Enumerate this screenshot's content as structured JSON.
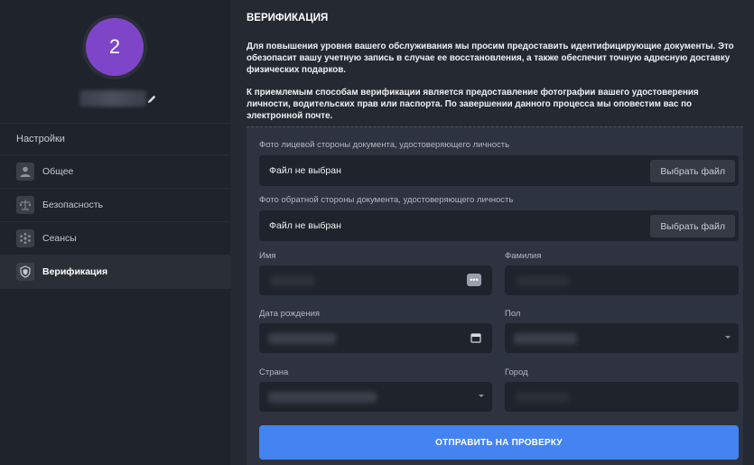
{
  "sidebar": {
    "avatar_number": "2",
    "settings_title": "Настройки",
    "items": [
      {
        "label": "Общее",
        "icon": "user-icon"
      },
      {
        "label": "Безопасность",
        "icon": "scales-icon"
      },
      {
        "label": "Сеансы",
        "icon": "sessions-icon"
      },
      {
        "label": "Верификация",
        "icon": "shield-icon",
        "active": true
      }
    ]
  },
  "main": {
    "title": "ВЕРИФИКАЦИЯ",
    "intro_1": "Для повышения уровня вашего обслуживания мы просим предоставить идентифицирующие документы. Это обезопасит вашу учетную запись в случае ее восстановления, а также обеспечит точную адресную доставку физических подарков.",
    "intro_2": "К приемлемым способам верификации является предоставление фотографии вашего удостоверения личности, водительских прав или паспорта. По завершении данного процесса мы оповестим вас по электронной почте.",
    "form": {
      "front_label": "Фото лицевой стороны документа, удостоверяющего личность",
      "back_label": "Фото обратной стороны документа, удостоверяющего личность",
      "file_status": "Файл не выбран",
      "choose_file": "Выбрать файл",
      "first_name_label": "Имя",
      "last_name_label": "Фамилия",
      "birth_date_label": "Дата рождения",
      "gender_label": "Пол",
      "country_label": "Страна",
      "city_label": "Город",
      "submit_label": "ОТПРАВИТЬ НА ПРОВЕРКУ"
    }
  },
  "colors": {
    "accent": "#4384f2",
    "avatar": "#7e45c9",
    "sidebar_bg": "#1f232b",
    "panel_bg": "#2e3340"
  }
}
